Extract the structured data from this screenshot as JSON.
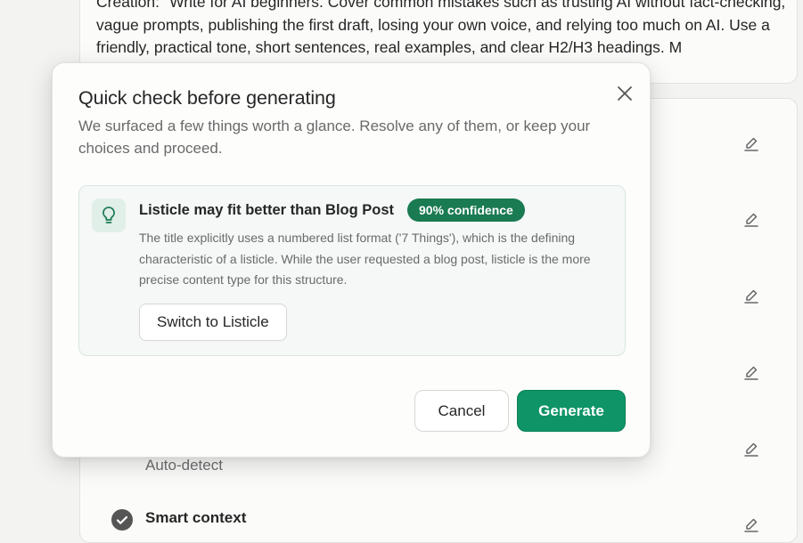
{
  "background": {
    "prompt_text": "Creation: \"Write for AI beginners. Cover common mistakes such as trusting AI without fact-checking, vague prompts, publishing the first draft, losing your own voice, and relying too much on AI. Use a friendly, practical tone, short sentences, real examples, and clear H2/H3 headings. M",
    "auto_detect_label": "Auto-detect",
    "smart_context_label": "Smart context"
  },
  "modal": {
    "title": "Quick check before generating",
    "description": "We surfaced a few things worth a glance. Resolve any of them, or keep your choices and proceed.",
    "suggestion": {
      "title": "Listicle may fit better than Blog Post",
      "confidence": "90% confidence",
      "body": "The title explicitly uses a numbered list format ('7 Things'), which is the defining characteristic of a listicle. While the user requested a blog post, listicle is the more precise content type for this structure.",
      "action_label": "Switch to Listicle"
    },
    "cancel_label": "Cancel",
    "generate_label": "Generate"
  },
  "icons": {
    "close": "close-icon",
    "bulb": "lightbulb-icon",
    "edit": "pencil-icon",
    "check": "check-circle-icon"
  },
  "colors": {
    "accent": "#0e9467",
    "badge": "#1a7a52",
    "suggestion_bg": "#f5f8f7",
    "bulb_bg": "#e0efe8"
  }
}
